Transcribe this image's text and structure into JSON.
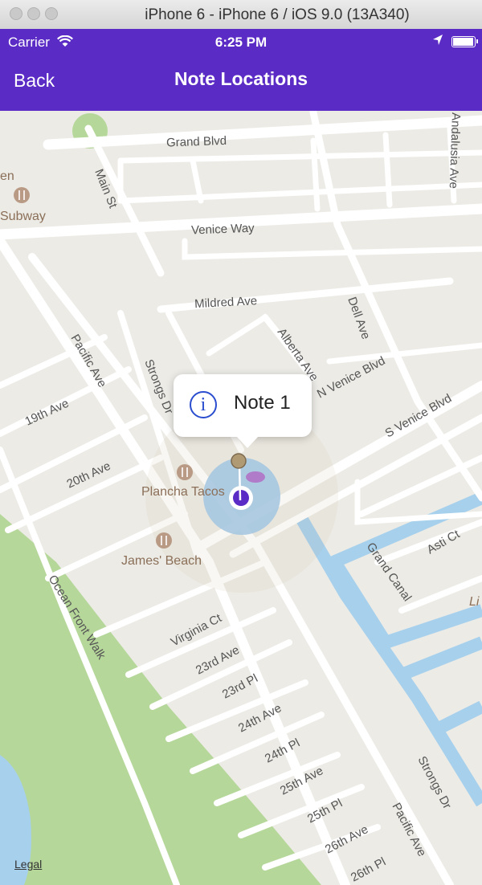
{
  "window": {
    "title": "iPhone 6 - iPhone 6 / iOS 9.0 (13A340)"
  },
  "status": {
    "carrier": "Carrier",
    "time": "6:25 PM",
    "battery_level": 1.0
  },
  "nav": {
    "back_label": "Back",
    "title": "Note Locations"
  },
  "map": {
    "streets": [
      "Grand Blvd",
      "Main St",
      "Venice Way",
      "Mildred Ave",
      "Pacific Ave",
      "Alberta Ave",
      "N Venice Blvd",
      "Dell Ave",
      "Andalusia Ave",
      "S Venice Blvd",
      "Strongs Dr",
      "19th Ave",
      "20th Ave",
      "Grand Canal",
      "Asti Ct",
      "Ocean Front Walk",
      "Virginia Ct",
      "23rd Ave",
      "23rd Pl",
      "24th Ave",
      "24th Pl",
      "25th Ave",
      "25th Pl",
      "26th Ave",
      "26th Pl"
    ],
    "pois": [
      "Subway",
      "Plancha Tacos",
      "James' Beach"
    ],
    "partial_labels": {
      "left_edge": "en",
      "right_edge": "Li"
    },
    "legal_label": "Legal"
  },
  "annotation": {
    "title": "Note 1",
    "info_symbol": "i"
  },
  "colors": {
    "nav_bg": "#5b2bc5",
    "map_land": "#ecebe6",
    "map_park": "#b6d79a",
    "map_water": "#a6d0ec",
    "road": "#ffffff",
    "accuracy_circle": "#9fc8ea",
    "user_dot": "#5b2bc5"
  }
}
